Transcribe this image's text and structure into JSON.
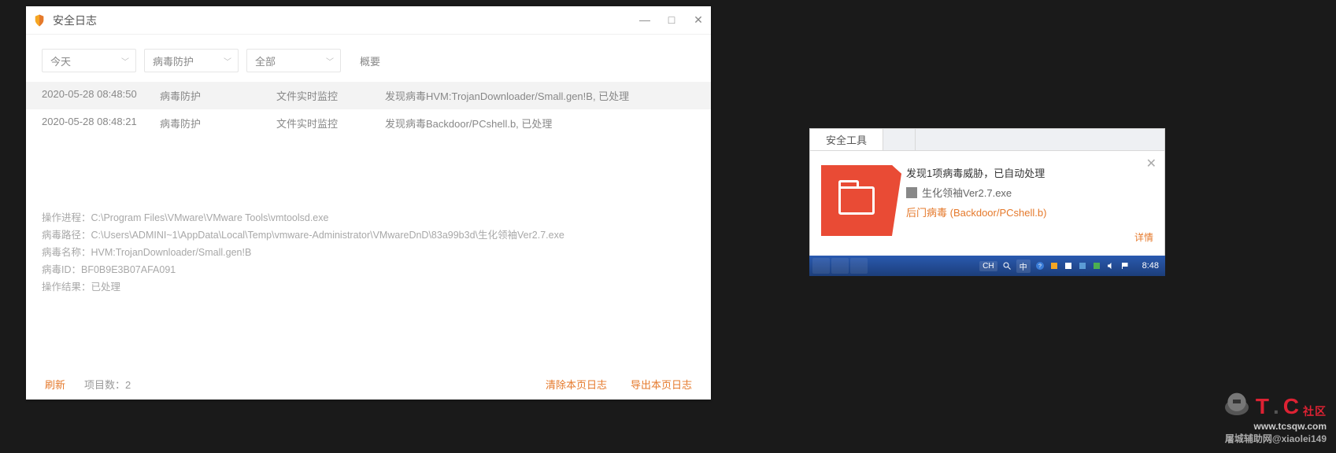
{
  "logWindow": {
    "title": "安全日志",
    "filters": {
      "date": "今天",
      "category": "病毒防护",
      "scope": "全部",
      "summaryHeader": "概要"
    },
    "rows": [
      {
        "time": "2020-05-28 08:48:50",
        "type": "病毒防护",
        "source": "文件实时监控",
        "summary": "发现病毒HVM:TrojanDownloader/Small.gen!B, 已处理"
      },
      {
        "time": "2020-05-28 08:48:21",
        "type": "病毒防护",
        "source": "文件实时监控",
        "summary": "发现病毒Backdoor/PCshell.b, 已处理"
      }
    ],
    "details": {
      "process": "操作进程：C:\\Program Files\\VMware\\VMware Tools\\vmtoolsd.exe",
      "path": "病毒路径：C:\\Users\\ADMINI~1\\AppData\\Local\\Temp\\vmware-Administrator\\VMwareDnD\\83a99b3d\\生化领袖Ver2.7.exe",
      "name": "病毒名称：HVM:TrojanDownloader/Small.gen!B",
      "id": "病毒ID：BF0B9E3B07AFA091",
      "result": "操作结果：已处理"
    },
    "footer": {
      "refresh": "刷新",
      "countLabel": "项目数：2",
      "clear": "清除本页日志",
      "export": "导出本页日志"
    }
  },
  "popup": {
    "tab": "安全工具",
    "title": "发现1项病毒威胁，已自动处理",
    "file": "生化领袖Ver2.7.exe",
    "threat": "后门病毒 (Backdoor/PCshell.b)",
    "detailLink": "详情"
  },
  "taskbar": {
    "lang": "CH",
    "ime": "中",
    "clock": "8:48"
  },
  "watermark": {
    "brand_t": "T",
    "brand_c": "C",
    "brand_suffix": "社区",
    "url": "www.tcsqw.com",
    "handle": "屠城辅助网@xiaolei149"
  }
}
